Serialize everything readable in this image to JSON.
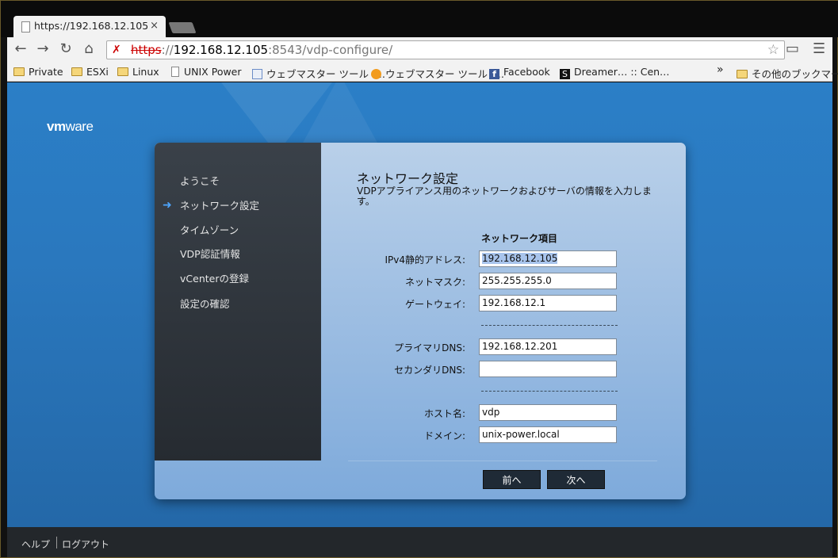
{
  "browser": {
    "tab_title": "https://192.168.12.105",
    "tab_close": "×",
    "url_scheme": "https",
    "url_sep": "://",
    "url_host": "192.168.12.105",
    "url_rest": ":8543/vdp-configure/"
  },
  "bookmarks": {
    "items": [
      {
        "label": "Private",
        "icon": "folder-icon"
      },
      {
        "label": "ESXi",
        "icon": "folder-icon"
      },
      {
        "label": "Linux",
        "icon": "folder-icon"
      },
      {
        "label": "UNIX Power",
        "icon": "page-icon"
      },
      {
        "label": "ウェブマスター ツール -…",
        "icon": "webmaster-icon"
      },
      {
        "label": "ウェブマスター ツール -…",
        "icon": "webmaster-orange-icon"
      },
      {
        "label": "Facebook",
        "icon": "facebook-icon"
      },
      {
        "label": "Dreamer… :: Cen…",
        "icon": "s-icon"
      }
    ],
    "overflow": "»",
    "other": "その他のブックマーク"
  },
  "app": {
    "logo_vm": "vm",
    "logo_ware": "ware"
  },
  "wizard": {
    "steps": [
      "ようこそ",
      "ネットワーク設定",
      "タイムゾーン",
      "VDP認証情報",
      "vCenterの登録",
      "設定の確認"
    ],
    "active_step": 1,
    "title": "ネットワーク設定",
    "description": "VDPアプライアンス用のネットワークおよびサーバの情報を入力します。",
    "section_heading": "ネットワーク項目",
    "fields": {
      "ipv4": {
        "label": "IPv4静的アドレス:",
        "value": "192.168.12.105"
      },
      "netmask": {
        "label": "ネットマスク:",
        "value": "255.255.255.0"
      },
      "gateway": {
        "label": "ゲートウェイ:",
        "value": "192.168.12.1"
      },
      "primary_dns": {
        "label": "プライマリDNS:",
        "value": "192.168.12.201"
      },
      "secondary_dns": {
        "label": "セカンダリDNS:",
        "value": ""
      },
      "hostname": {
        "label": "ホスト名:",
        "value": "vdp"
      },
      "domain": {
        "label": "ドメイン:",
        "value": "unix-power.local"
      }
    },
    "buttons": {
      "back": "前へ",
      "next": "次へ"
    }
  },
  "footer": {
    "help": "ヘルプ",
    "logout": "ログアウト"
  }
}
